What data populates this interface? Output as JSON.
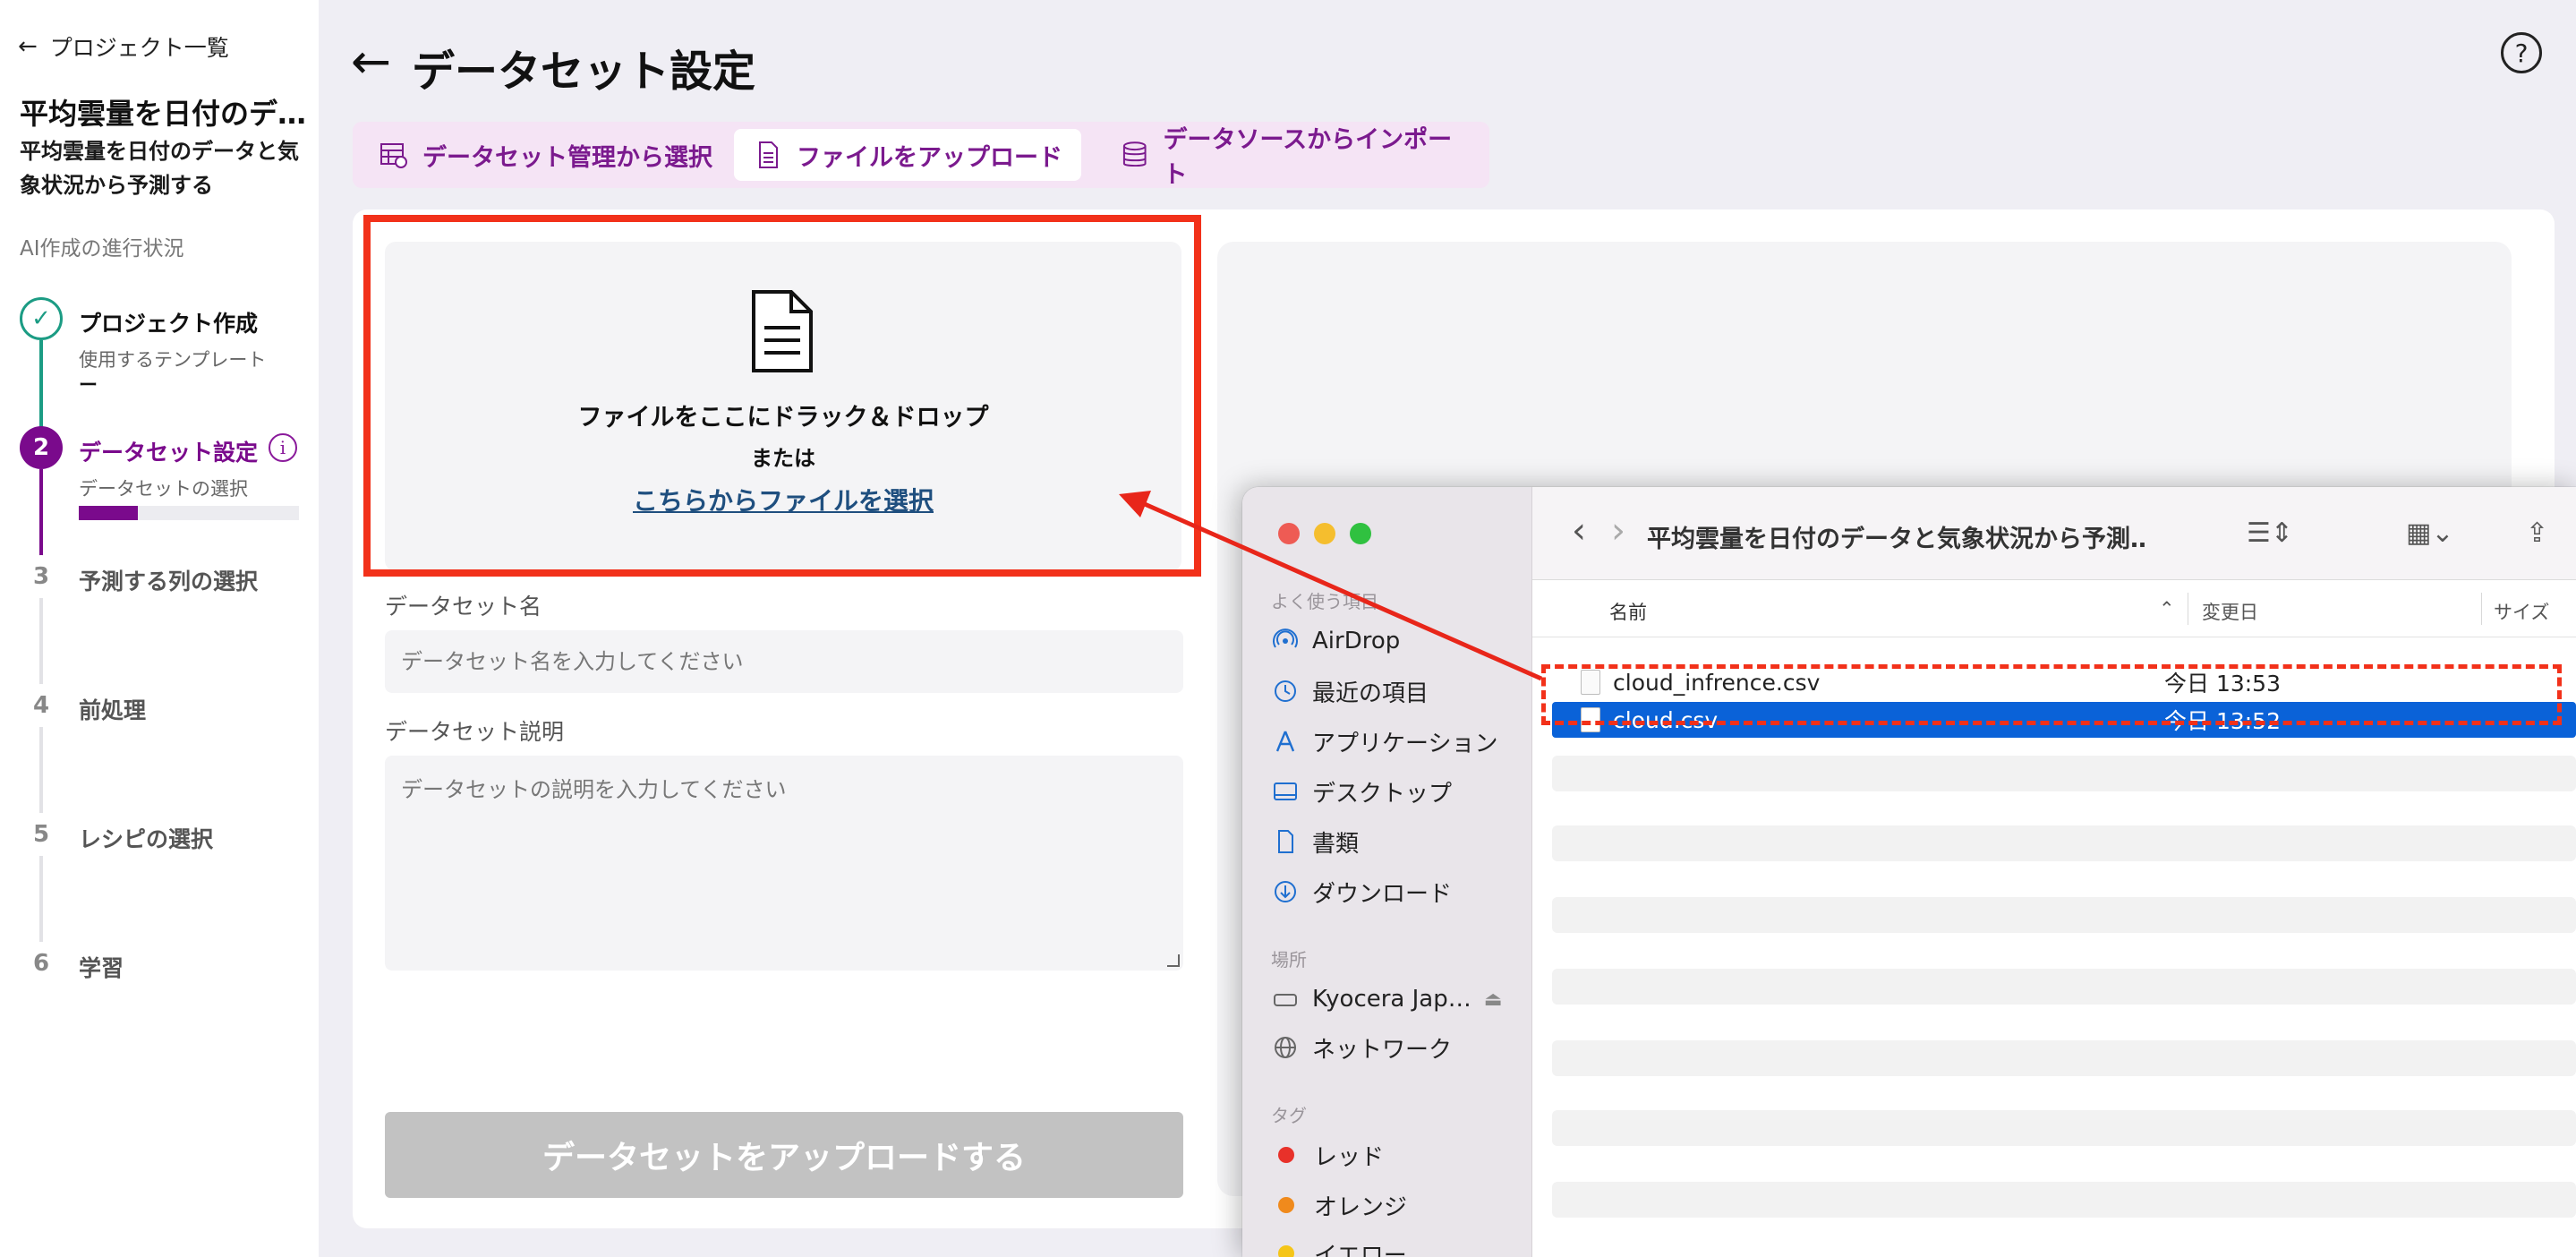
{
  "sidebar": {
    "back_label": "プロジェクト一覧",
    "project_title": "平均雲量を日付のデ…",
    "project_desc": "平均雲量を日付のデータと気象状況から予測する",
    "progress_label": "AI作成の進行状況",
    "steps": [
      {
        "num": "✓",
        "title": "プロジェクト作成",
        "sub": "使用するテンプレート",
        "sub2": "ー"
      },
      {
        "num": "2",
        "title": "データセット設定",
        "sub": "データセットの選択"
      },
      {
        "num": "3",
        "title": "予測する列の選択"
      },
      {
        "num": "4",
        "title": "前処理"
      },
      {
        "num": "5",
        "title": "レシピの選択"
      },
      {
        "num": "6",
        "title": "学習"
      }
    ],
    "dataset_progress": 0.27
  },
  "header": {
    "title": "データセット設定",
    "help": "?"
  },
  "tabs": [
    {
      "label": "データセット管理から選択",
      "icon": "dataset-table-icon"
    },
    {
      "label": "ファイルをアップロード",
      "icon": "document-icon"
    },
    {
      "label": "データソースからインポート",
      "icon": "database-icon"
    }
  ],
  "upload": {
    "drop_title": "ファイルをここにドラック＆ドロップ",
    "or": "または",
    "select_link": "こちらからファイルを選択"
  },
  "form": {
    "name_label": "データセット名",
    "name_placeholder": "データセット名を入力してください",
    "desc_label": "データセット説明",
    "desc_placeholder": "データセットの説明を入力してください",
    "submit_label": "データセットをアップロードする"
  },
  "finder": {
    "title": "平均雲量を日付のデータと気象状況から予測…",
    "favorites_heading": "よく使う項目",
    "favorites": [
      "AirDrop",
      "最近の項目",
      "アプリケーション",
      "デスクトップ",
      "書類",
      "ダウンロード"
    ],
    "locations_heading": "場所",
    "locations": [
      "Kyocera Jap…",
      "ネットワーク"
    ],
    "tags_heading": "タグ",
    "tags": [
      {
        "name": "レッド",
        "color": "#e8312a"
      },
      {
        "name": "オレンジ",
        "color": "#f08a1c"
      },
      {
        "name": "イエロー",
        "color": "#f5c518"
      }
    ],
    "columns": {
      "name": "名前",
      "modified": "変更日",
      "size": "サイズ"
    },
    "files": [
      {
        "name": "cloud_infrence.csv",
        "modified": "今日 13:53",
        "selected": false
      },
      {
        "name": "cloud.csv",
        "modified": "今日 13:52",
        "selected": true
      }
    ]
  },
  "colors": {
    "accent": "#7a0a8c",
    "step_done": "#1c9c84",
    "highlight": "#f2311a",
    "finder_select": "#0a62d8"
  }
}
